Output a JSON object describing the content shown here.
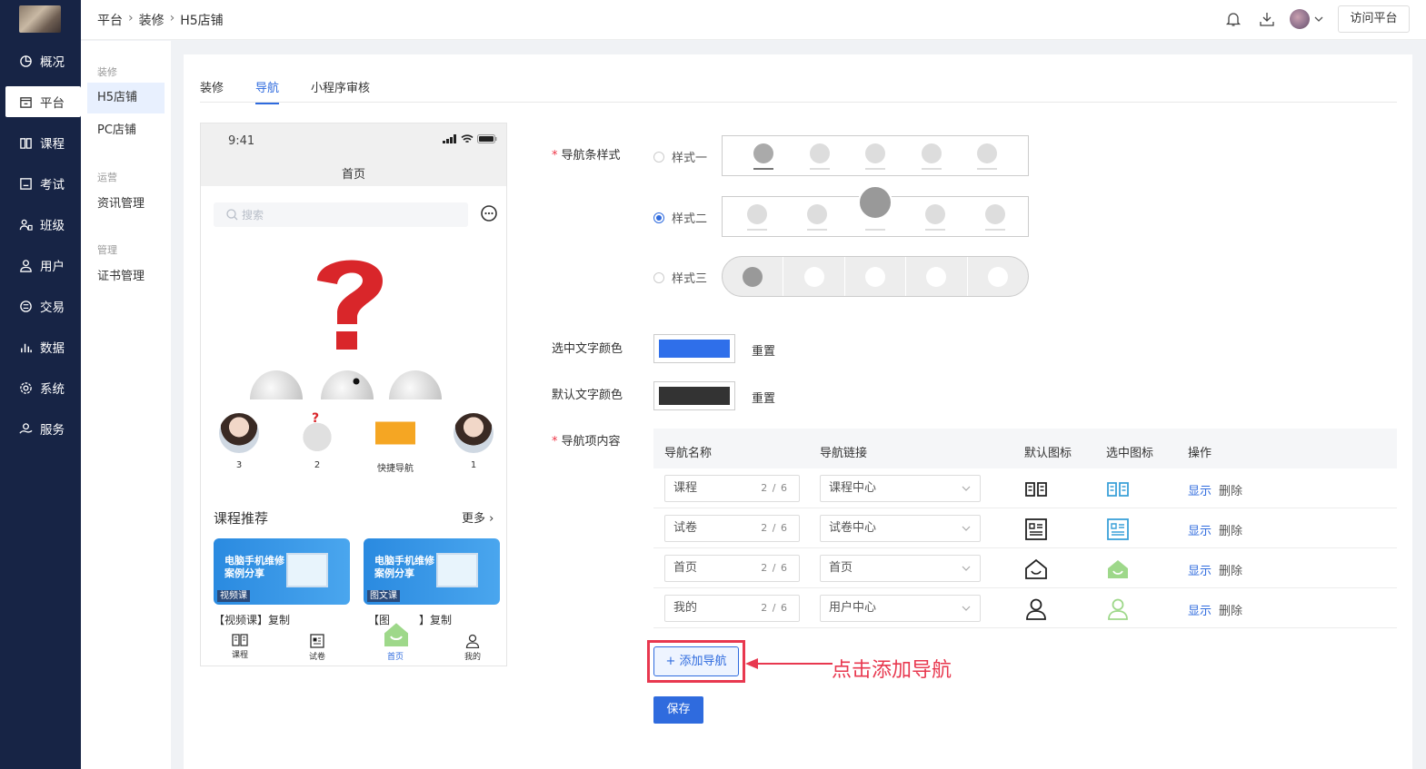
{
  "sidebar": {
    "items": [
      {
        "label": "概况",
        "icon": "pie-chart-icon"
      },
      {
        "label": "平台",
        "icon": "store-icon"
      },
      {
        "label": "课程",
        "icon": "book-icon"
      },
      {
        "label": "考试",
        "icon": "exam-icon"
      },
      {
        "label": "班级",
        "icon": "group-icon"
      },
      {
        "label": "用户",
        "icon": "user-icon"
      },
      {
        "label": "交易",
        "icon": "transaction-icon"
      },
      {
        "label": "数据",
        "icon": "bar-chart-icon"
      },
      {
        "label": "系统",
        "icon": "gear-icon"
      },
      {
        "label": "服务",
        "icon": "service-icon"
      }
    ]
  },
  "submenu": {
    "group1": "装修",
    "item_h5": "H5店铺",
    "item_pc": "PC店铺",
    "group2": "运营",
    "item_news": "资讯管理",
    "group3": "管理",
    "item_cert": "证书管理"
  },
  "header": {
    "breadcrumb": [
      "平台",
      "装修",
      "H5店铺"
    ],
    "visit_label": "访问平台"
  },
  "tabs": [
    "装修",
    "导航",
    "小程序审核"
  ],
  "phone": {
    "time": "9:41",
    "title": "首页",
    "search_placeholder": "搜索",
    "quicknav": [
      "3",
      "2",
      "快捷导航",
      "1"
    ],
    "section_title": "课程推荐",
    "section_more": "更多",
    "card_text": "电脑手机维修案例分享",
    "card1_badge": "视频课",
    "card2_badge": "图文课",
    "card1_name": "【视频课】复制",
    "card2_name_a": "【图",
    "card2_name_b": "】复制",
    "tabbar": [
      "课程",
      "试卷",
      "首页",
      "我的"
    ]
  },
  "form": {
    "nav_style_label": "导航条样式",
    "style1": "样式一",
    "style2": "样式二",
    "style3": "样式三",
    "selected_color_label": "选中文字颜色",
    "selected_color": "#2f6fea",
    "default_color_label": "默认文字颜色",
    "default_color": "#333333",
    "reset": "重置",
    "items_label": "导航项内容"
  },
  "table": {
    "headers": [
      "导航名称",
      "导航链接",
      "默认图标",
      "选中图标",
      "操作"
    ],
    "rows": [
      {
        "name": "课程",
        "count": "2 / 6",
        "link": "课程中心",
        "icon": "book-icon"
      },
      {
        "name": "试卷",
        "count": "2 / 6",
        "link": "试卷中心",
        "icon": "paper-icon"
      },
      {
        "name": "首页",
        "count": "2 / 6",
        "link": "首页",
        "icon": "home-icon"
      },
      {
        "name": "我的",
        "count": "2 / 6",
        "link": "用户中心",
        "icon": "user-icon"
      }
    ],
    "op_show": "显示",
    "op_delete": "删除"
  },
  "actions": {
    "add_nav": "+ 添加导航",
    "annotation": "点击添加导航",
    "save": "保存"
  },
  "colors": {
    "accent": "#2f6bde",
    "sidebar_bg": "#172445",
    "active_icon": "#9ed88a",
    "highlight": "#e8384f"
  }
}
